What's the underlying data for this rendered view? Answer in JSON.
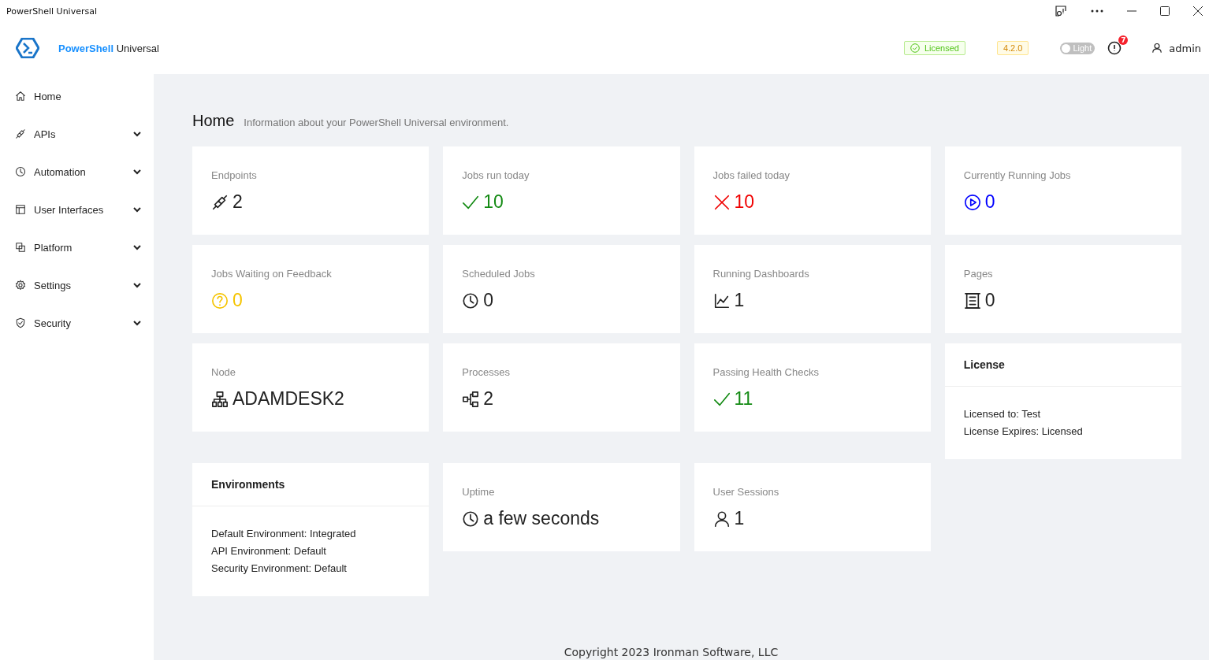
{
  "window": {
    "title": "PowerShell Universal"
  },
  "header": {
    "brand_primary": "PowerShell",
    "brand_secondary": "Universal",
    "license_badge": "Licensed",
    "version_badge": "4.2.0",
    "theme_toggle": {
      "label": "Light",
      "on": false
    },
    "notifications": {
      "count": "7"
    },
    "user": "admin"
  },
  "sidebar": {
    "items": [
      {
        "label": "Home",
        "expandable": false
      },
      {
        "label": "APIs",
        "expandable": true
      },
      {
        "label": "Automation",
        "expandable": true
      },
      {
        "label": "User Interfaces",
        "expandable": true
      },
      {
        "label": "Platform",
        "expandable": true
      },
      {
        "label": "Settings",
        "expandable": true
      },
      {
        "label": "Security",
        "expandable": true
      }
    ]
  },
  "page": {
    "title": "Home",
    "subtitle": "Information about your PowerShell Universal environment."
  },
  "cards": [
    {
      "kind": "stat",
      "label": "Endpoints",
      "value": "2",
      "color": "#222222"
    },
    {
      "kind": "stat",
      "label": "Jobs run today",
      "value": "10",
      "color": "#138a13"
    },
    {
      "kind": "stat",
      "label": "Jobs failed today",
      "value": "10",
      "color": "#f00000"
    },
    {
      "kind": "stat",
      "label": "Currently Running Jobs",
      "value": "0",
      "color": "#0000ff"
    },
    {
      "kind": "stat",
      "label": "Jobs Waiting on Feedback",
      "value": "0",
      "color": "#f5c400"
    },
    {
      "kind": "stat",
      "label": "Scheduled Jobs",
      "value": "0",
      "color": "#222222"
    },
    {
      "kind": "stat",
      "label": "Running Dashboards",
      "value": "1",
      "color": "#222222"
    },
    {
      "kind": "stat",
      "label": "Pages",
      "value": "0",
      "color": "#222222"
    },
    {
      "kind": "stat",
      "label": "Node",
      "value": "ADAMDESK2",
      "color": "#222222"
    },
    {
      "kind": "stat",
      "label": "Processes",
      "value": "2",
      "color": "#222222"
    },
    {
      "kind": "stat",
      "label": "Passing Health Checks",
      "value": "11",
      "color": "#138a13"
    },
    {
      "kind": "info",
      "label": "License",
      "lines": [
        "Licensed to: Test",
        "License Expires: Licensed"
      ]
    },
    {
      "kind": "info",
      "label": "Environments",
      "lines": [
        "Default Environment: Integrated",
        "API Environment: Default",
        "Security Environment: Default"
      ]
    },
    {
      "kind": "stat",
      "label": "Uptime",
      "value": "a few seconds",
      "color": "#222222"
    },
    {
      "kind": "stat",
      "label": "User Sessions",
      "value": "1",
      "color": "#222222"
    }
  ],
  "footer": "Copyright 2023 Ironman Software, LLC"
}
